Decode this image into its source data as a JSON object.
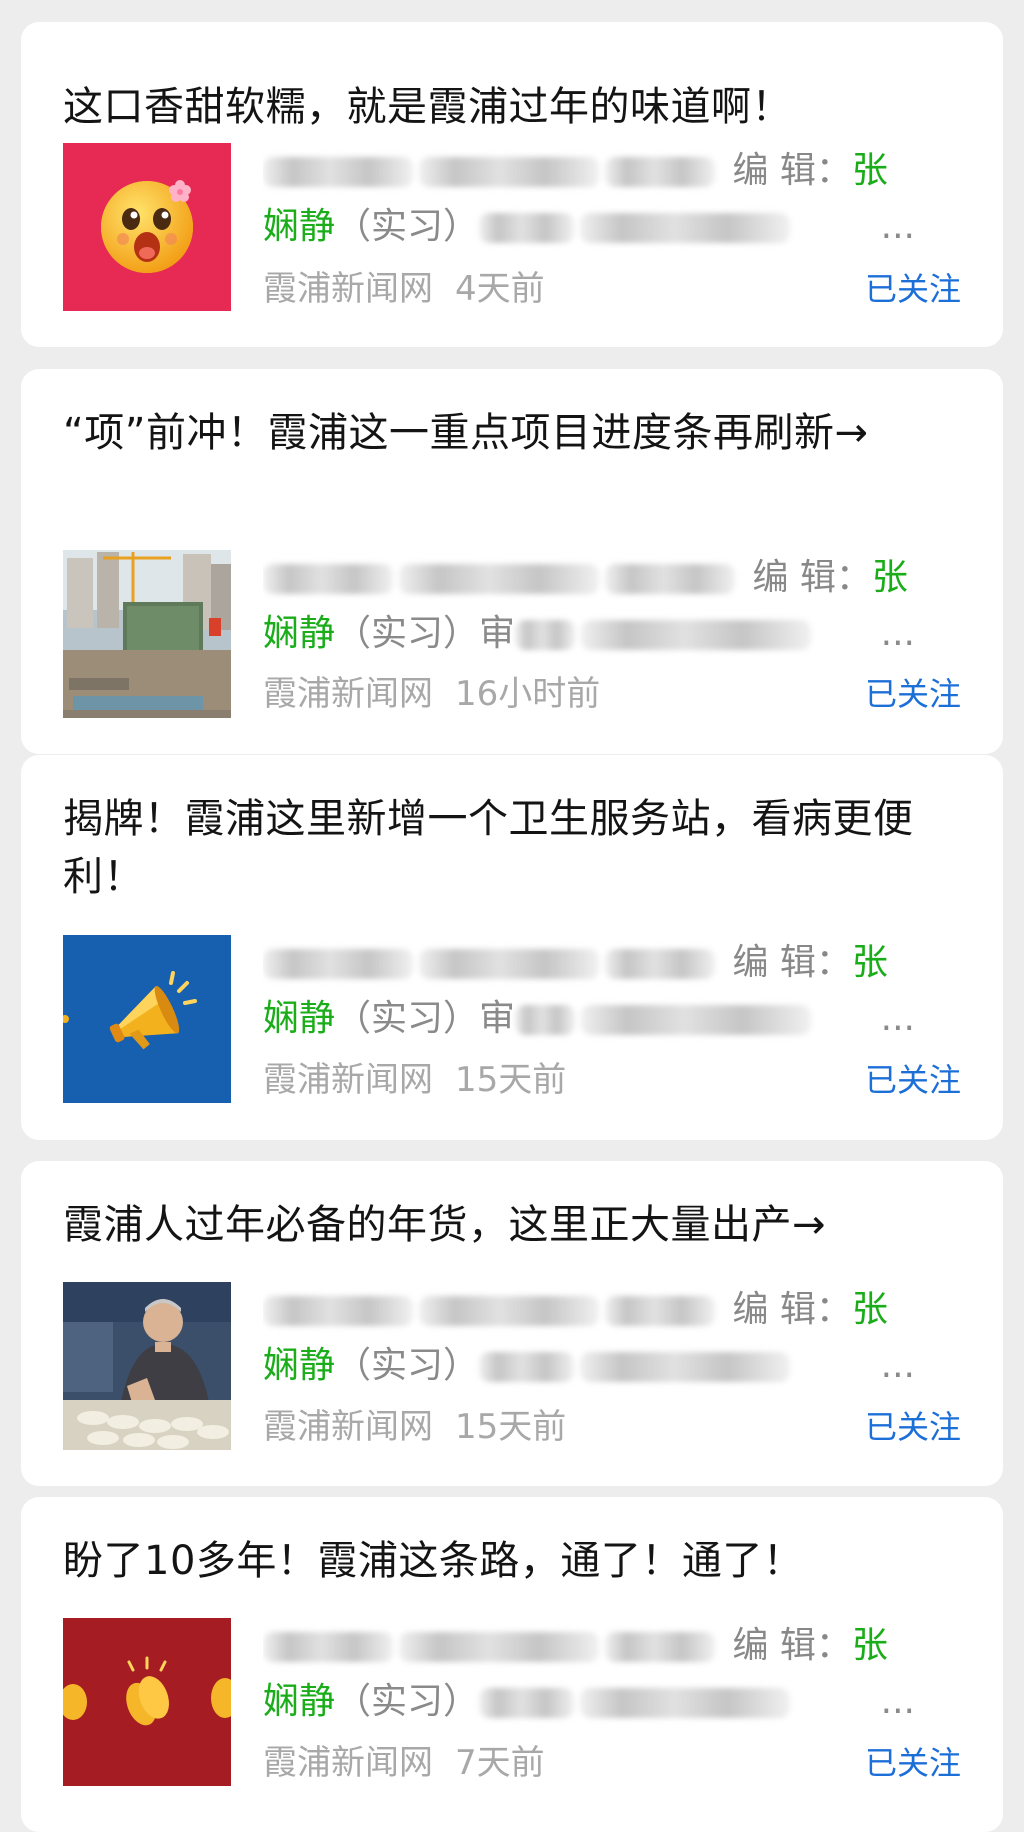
{
  "feed": {
    "items": [
      {
        "title": "这口香甜软糯，就是霞浦过年的味道啊！",
        "desc": {
          "editor_label": "编 辑：",
          "editor_first": "张",
          "editor_second": "娴静",
          "intern": "（实习）",
          "ellipsis": "..."
        },
        "source": "霞浦新闻网",
        "time": "4天前",
        "follow_label": "已关注",
        "thumb_icon": "surprised-face-emoji-icon",
        "thumb_color": "#e62a54"
      },
      {
        "title": "“项”前冲！霞浦这一重点项目进度条再刷新→",
        "desc": {
          "editor_label": "编 辑：",
          "editor_first": "张",
          "editor_second": "娴静",
          "intern": "（实习）",
          "audit_char": "审",
          "ellipsis": "..."
        },
        "source": "霞浦新闻网",
        "time": "16小时前",
        "follow_label": "已关注",
        "thumb_icon": "construction-site-photo",
        "thumb_color": "#8a9aa8"
      },
      {
        "title": "揭牌！霞浦这里新增一个卫生服务站，看病更便利！",
        "desc": {
          "editor_label": "编 辑：",
          "editor_first": "张",
          "editor_second": "娴静",
          "intern": "（实习）",
          "audit_char": "审",
          "ellipsis": "..."
        },
        "source": "霞浦新闻网",
        "time": "15天前",
        "follow_label": "已关注",
        "thumb_icon": "megaphone-icon",
        "thumb_color": "#1760b0"
      },
      {
        "title": "霞浦人过年必备的年货，这里正大量出产→",
        "desc": {
          "editor_label": "编 辑：",
          "editor_first": "张",
          "editor_second": "娴静",
          "intern": "（实习）",
          "ellipsis": "..."
        },
        "source": "霞浦新闻网",
        "time": "15天前",
        "follow_label": "已关注",
        "thumb_icon": "man-with-rice-cakes-photo",
        "thumb_color": "#3b4f6a"
      },
      {
        "title": "盼了10多年！霞浦这条路，通了！通了！",
        "desc": {
          "editor_label": "编 辑：",
          "editor_first": "张",
          "editor_second": "娴静",
          "intern": "（实习）",
          "ellipsis": "..."
        },
        "source": "霞浦新闻网",
        "time": "7天前",
        "follow_label": "已关注",
        "thumb_icon": "clapping-hands-icon",
        "thumb_color": "#a51d22"
      }
    ]
  }
}
